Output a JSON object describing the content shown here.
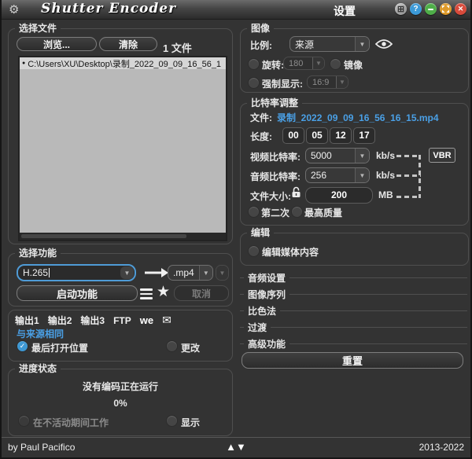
{
  "titlebar": {
    "title": "Shutter Encoder",
    "settings": "设置"
  },
  "icons": {
    "dropdown": "▼",
    "star": "★",
    "envelope": "✉",
    "check": "✓",
    "gear": "⚙",
    "pin": "⊞",
    "help": "?",
    "close": "✕",
    "bullet": "●",
    "up": "▲",
    "down": "▼",
    "we": "we"
  },
  "left": {
    "file_section": {
      "title": "选择文件",
      "browse": "浏览...",
      "clear": "清除",
      "count": "1 文件",
      "file_item": "C:\\Users\\XU\\Desktop\\录制_2022_09_09_16_56_1"
    },
    "function_section": {
      "title": "选择功能",
      "codec": "H.265",
      "extension": ".mp4",
      "start": "启动功能",
      "cancel": "取消"
    },
    "output_section": {
      "tabs": [
        "输出1",
        "输出2",
        "输出3",
        "FTP"
      ],
      "same_as_source": "与来源相同",
      "last_location": "最后打开位置",
      "change": "更改"
    },
    "progress_section": {
      "title": "进度状态",
      "status": "没有编码正在运行",
      "percent": "0%",
      "work_inactive": "在不活动期间工作",
      "show": "显示"
    }
  },
  "right": {
    "image_section": {
      "title": "图像",
      "ratio_label": "比例:",
      "ratio_value": "来源",
      "rotate_label": "旋转:",
      "rotate_value": "180",
      "mirror_label": "镜像",
      "force_label": "强制显示:",
      "force_value": "16:9"
    },
    "bitrate_section": {
      "title": "比特率调整",
      "file_label": "文件:",
      "file_value": "录制_2022_09_09_16_56_16_15.mp4",
      "length_label": "长度:",
      "time": [
        "00",
        "05",
        "12",
        "17"
      ],
      "video_label": "视频比特率:",
      "video_value": "5000",
      "kbps_unit": "kb/s",
      "vbr": "VBR",
      "audio_label": "音频比特率:",
      "audio_value": "256",
      "size_label": "文件大小:",
      "size_value": "200",
      "size_unit": "MB",
      "second_pass": "第二次",
      "best_quality": "最高质量"
    },
    "edit_section": {
      "title": "编辑",
      "edit_media": "编辑媒体内容"
    },
    "collapsed": [
      "音频设置",
      "图像序列",
      "比色法",
      "过渡",
      "高级功能"
    ],
    "reset": "重置"
  },
  "footer": {
    "author": "by Paul Pacifico",
    "years": "2013-2022"
  },
  "colors": {
    "background": "#333333",
    "accent_blue": "#4aa0e6",
    "radio_checked": "#3d98d4",
    "list_background": "#b9b9b9",
    "help_button": "#3c9ad8",
    "minimize_button": "#4fae49",
    "maximize_button": "#de9a2a",
    "close_button": "#d84a3b"
  }
}
